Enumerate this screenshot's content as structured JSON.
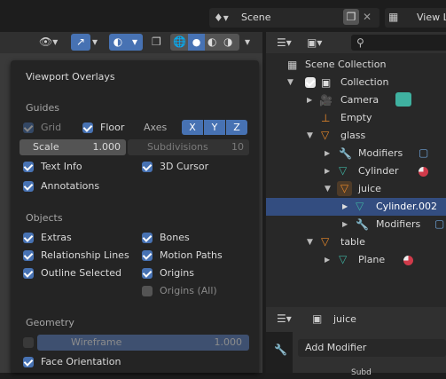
{
  "top": {
    "scene": "Scene",
    "view_layer": "View L"
  },
  "overlays": {
    "title": "Viewport Overlays",
    "guides": {
      "section": "Guides",
      "grid": "Grid",
      "floor": "Floor",
      "axes": "Axes",
      "x": "X",
      "y": "Y",
      "z": "Z",
      "scale_label": "Scale",
      "scale_value": "1.000",
      "subdiv_label": "Subdivisions",
      "subdiv_value": "10",
      "text_info": "Text Info",
      "cursor_3d": "3D Cursor",
      "annotations": "Annotations"
    },
    "objects": {
      "section": "Objects",
      "extras": "Extras",
      "bones": "Bones",
      "relationship_lines": "Relationship Lines",
      "motion_paths": "Motion Paths",
      "outline_selected": "Outline Selected",
      "origins": "Origins",
      "origins_all": "Origins (All)"
    },
    "geometry": {
      "section": "Geometry",
      "wireframe_label": "Wireframe",
      "wireframe_value": "1.000",
      "face_orientation": "Face Orientation"
    }
  },
  "outliner": {
    "items": [
      {
        "label": "Scene Collection"
      },
      {
        "label": "Collection"
      },
      {
        "label": "Camera"
      },
      {
        "label": "Empty"
      },
      {
        "label": "glass"
      },
      {
        "label": "Modifiers"
      },
      {
        "label": "Cylinder"
      },
      {
        "label": "juice"
      },
      {
        "label": "Cylinder.002"
      },
      {
        "label": "Modifiers"
      },
      {
        "label": "table"
      },
      {
        "label": "Plane"
      }
    ]
  },
  "properties": {
    "object_name": "juice",
    "add_modifier": "Add Modifier",
    "partial": "Subd"
  },
  "colors": {
    "accent": "#4772b3",
    "selected_row": "#334d80",
    "orange": "#e8882a",
    "teal": "#3fb1a0"
  }
}
